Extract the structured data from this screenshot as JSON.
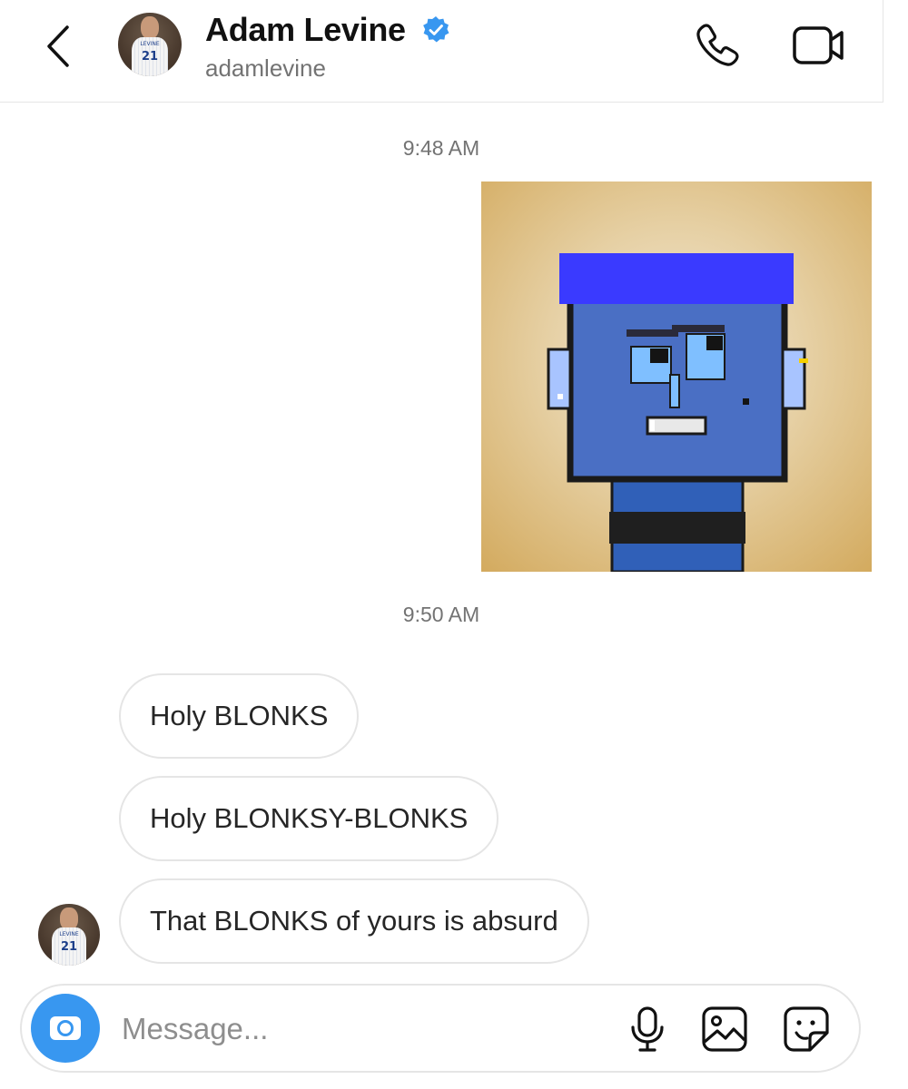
{
  "header": {
    "contact_name": "Adam Levine",
    "contact_handle": "adamlevine",
    "verified": true,
    "avatar_jersey_number": "21",
    "avatar_jersey_name": "LEVINE"
  },
  "conversation": {
    "timestamps": [
      "9:48 AM",
      "9:50 AM"
    ],
    "messages": [
      {
        "text": "Holy BLONKS"
      },
      {
        "text": "Holy BLONKSY-BLONKS"
      },
      {
        "text": "That BLONKS of yours is absurd"
      }
    ]
  },
  "composer": {
    "placeholder": "Message...",
    "value": ""
  },
  "colors": {
    "accent": "#3897f0",
    "verified_badge": "#3897f0",
    "bubble_border": "#e5e5e5",
    "secondary_text": "#737373"
  },
  "icons": [
    "back-chevron-icon",
    "verified-badge-icon",
    "phone-icon",
    "video-camera-icon",
    "camera-icon",
    "microphone-icon",
    "gallery-icon",
    "sticker-icon"
  ]
}
